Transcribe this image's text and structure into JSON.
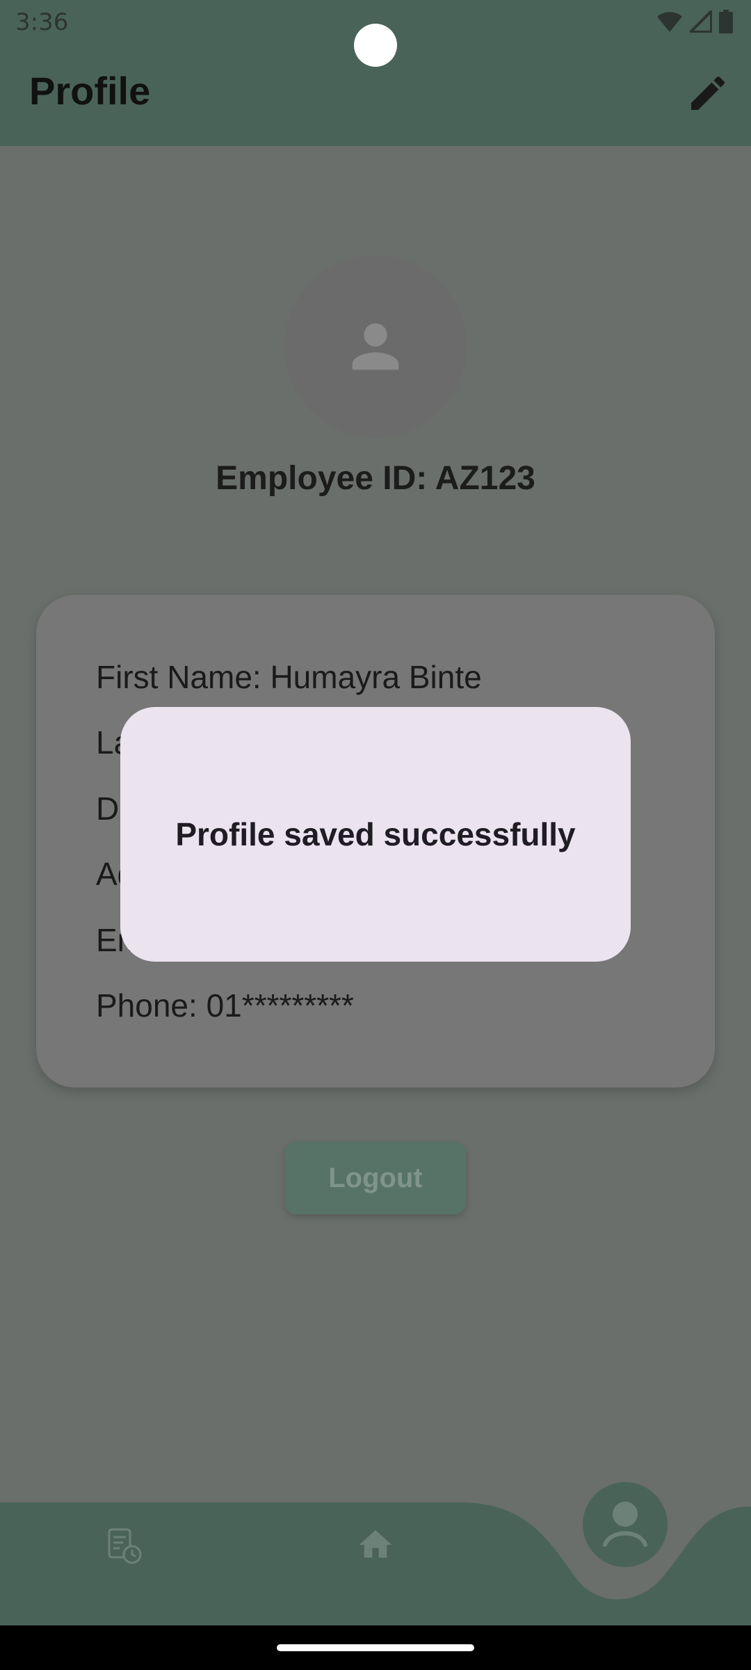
{
  "status_bar": {
    "time": "3:36"
  },
  "app_bar": {
    "title": "Profile"
  },
  "profile": {
    "employee_id": "Employee ID: AZ123",
    "fields": [
      "First Name: Humayra Binte",
      "La",
      "Da",
      "Ad",
      "Em",
      "Phone: 01*********"
    ]
  },
  "logout_label": "Logout",
  "dialog": {
    "message": "Profile saved successfully"
  },
  "colors": {
    "appbar": "#4a6359",
    "scrim_bg": "#6a6f6b",
    "card": "#777777",
    "dialog": "#ebe4ef",
    "logout": "#577266"
  },
  "icons": [
    "wifi-icon",
    "signal-icon",
    "battery-icon",
    "edit-icon",
    "person-icon",
    "history-icon",
    "home-icon",
    "profile-icon"
  ]
}
